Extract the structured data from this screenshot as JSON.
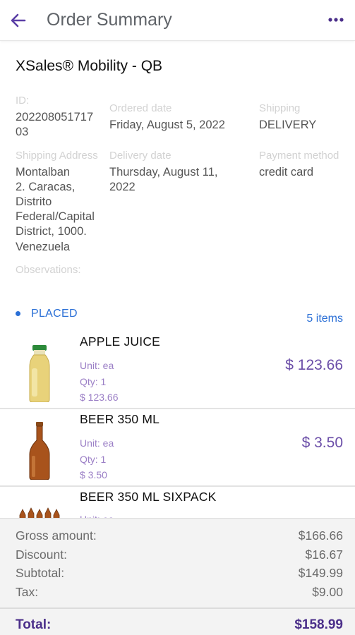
{
  "header": {
    "title": "Order Summary"
  },
  "company": "XSales® Mobility - QB",
  "details": {
    "id_label": "ID:",
    "id_line1": "202208051717",
    "id_line2": "03",
    "ordered_label": "Ordered date",
    "ordered_value": "Friday, August 5, 2022",
    "shipping_label": "Shipping",
    "shipping_value": "DELIVERY",
    "address_label": "Shipping Address",
    "address_lines": [
      "Montalban",
      "2. Caracas,",
      "Distrito",
      "Federal/Capital",
      "District, 1000.",
      "Venezuela"
    ],
    "delivery_label": "Delivery date",
    "delivery_line1": "Thursday, August 11,",
    "delivery_line2": "2022",
    "payment_label": "Payment method",
    "payment_value": "credit card",
    "observations_label": "Observations:"
  },
  "status": {
    "label": "PLACED",
    "items_count": "5 items"
  },
  "items": [
    {
      "name": "APPLE JUICE",
      "unit": "Unit: ea",
      "qty": "Qty: 1",
      "line_price": "$ 123.66",
      "price": "$ 123.66",
      "icon": "juice-bottle-icon"
    },
    {
      "name": "BEER 350 ML",
      "unit": "Unit: ea",
      "qty": "Qty: 1",
      "line_price": "$ 3.50",
      "price": "$ 3.50",
      "icon": "beer-bottle-icon"
    },
    {
      "name": "BEER 350 ML SIXPACK",
      "unit": "Unit: ea",
      "icon": "sixpack-icon"
    }
  ],
  "totals": {
    "gross_label": "Gross amount:",
    "gross_value": "$166.66",
    "discount_label": "Discount:",
    "discount_value": "$16.67",
    "subtotal_label": "Subtotal:",
    "subtotal_value": "$149.99",
    "tax_label": "Tax:",
    "tax_value": "$9.00",
    "total_label": "Total:",
    "total_value": "$158.99"
  },
  "colors": {
    "accent": "#6b4ea8",
    "status": "#2a6fd6",
    "back_arrow": "#5b3fa6"
  }
}
